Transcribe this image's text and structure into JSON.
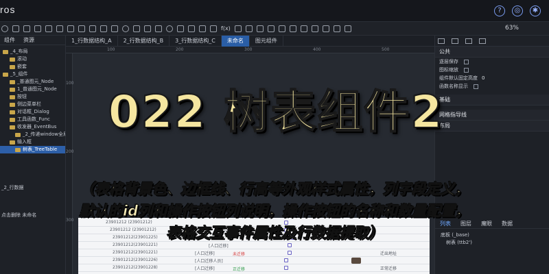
{
  "app": {
    "brand": "ros",
    "zoom": "63%"
  },
  "left_panel": {
    "tabs": [
      "组件",
      "资源"
    ],
    "tree": [
      "_4_布局",
      "滚动",
      "嵌套",
      "_5_组件",
      "_普通图元_Node",
      "1_普通图元_Node",
      "按钮",
      "侧边菜单栏",
      "对话框_Dialog",
      "工具函数_Func",
      "收发器_EventBus",
      "_2_传递window全局",
      "输入框",
      "树表_TreeTable"
    ],
    "footer": [
      "_2_行数据",
      "点击删除  未命名"
    ]
  },
  "doc_tabs": [
    "1_行数据结构_A",
    "2_行数据结构_B",
    "3_行数据结构_C",
    "未命名",
    "图元组件"
  ],
  "right_panel": {
    "sections": {
      "public": "公共",
      "basic": "基础",
      "grid": "网格指导线",
      "layout": "布局"
    },
    "props": [
      {
        "label": "逐层保存",
        "type": "check"
      },
      {
        "label": "图标缩放",
        "type": "check"
      },
      {
        "label": "组件默认固定高度",
        "type": "value",
        "value": "0"
      },
      {
        "label": "函数名称显示",
        "type": "check"
      }
    ],
    "tabs": [
      "列表",
      "图层",
      "魔眼",
      "数据"
    ],
    "list": [
      "底板 (_base)",
      "树表 (ttb2')"
    ]
  },
  "table": {
    "ids": [
      "23901212 (23901212)",
      "23901212 (23901212)",
      "23901212(23901225)",
      "23901212(23901221)",
      "23901212(23901221)",
      "23901212(23901226)",
      "23901212(23901228)"
    ],
    "cells": [
      "[人口迁移]",
      "[人口迁移人员]",
      "[人口迁移]",
      "未迁移",
      "正迁移",
      "迁出地址",
      "正常迁移"
    ]
  },
  "overlay": {
    "headline": "022 树表组件2",
    "sub_lines": [
      "（表格背景色、边框线、行高等外观样式属性，列字段定义，",
      "默认的id列和操作按钮列说明，操作按钮的名称和数量配置，",
      "表格交互事件属性及行数据提取）"
    ]
  }
}
